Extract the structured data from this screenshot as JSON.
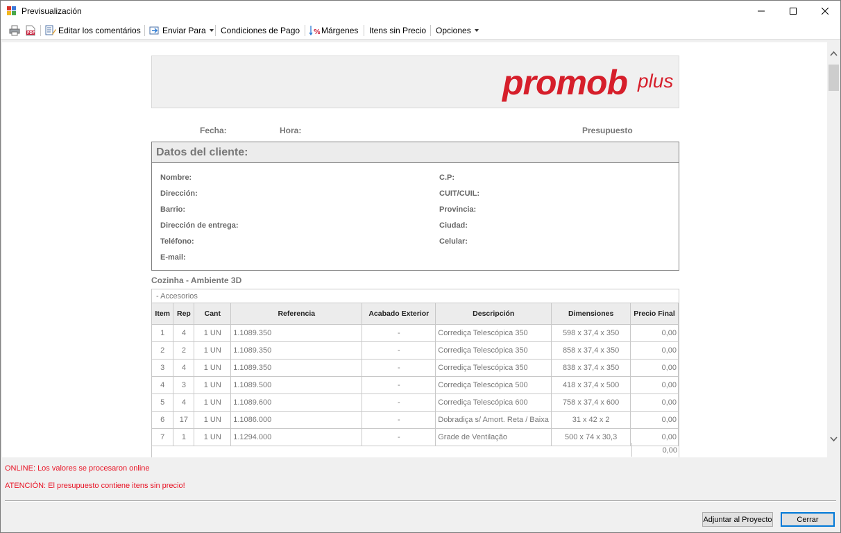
{
  "window": {
    "title": "Previsualización"
  },
  "toolbar": {
    "edit_comments": "Editar los comentários",
    "send_to": "Enviar Para",
    "payment_conditions": "Condiciones de Pago",
    "margins": "Márgenes",
    "items_no_price": "Itens sin Precio",
    "options": "Opciones"
  },
  "document": {
    "logo_main": "promob",
    "logo_plus": "plus",
    "date_label": "Fecha:",
    "time_label": "Hora:",
    "budget_label": "Presupuesto",
    "client_section": {
      "title": "Datos del cliente:",
      "left_fields": [
        "Nombre:",
        "Dirección:",
        "Barrio:",
        "Dirección de entrega:",
        "Teléfono:",
        "E-mail:"
      ],
      "right_fields": [
        "C.P:",
        "CUIT/CUIL:",
        "Provincia:",
        "Ciudad:",
        "Celular:"
      ]
    },
    "ambiente": "Cozinha - Ambiente 3D",
    "group_label": "- Accesorios",
    "columns": [
      "Item",
      "Rep",
      "Cant",
      "Referencia",
      "Acabado Exterior",
      "Descripción",
      "Dimensiones",
      "Precio Final"
    ],
    "rows": [
      [
        "1",
        "4",
        "1 UN",
        "1.1089.350",
        "-",
        "Corrediça Telescópica 350",
        "598 x 37,4 x 350",
        "0,00"
      ],
      [
        "2",
        "2",
        "1 UN",
        "1.1089.350",
        "-",
        "Corrediça Telescópica 350",
        "858 x 37,4 x 350",
        "0,00"
      ],
      [
        "3",
        "4",
        "1 UN",
        "1.1089.350",
        "-",
        "Corrediça Telescópica 350",
        "838 x 37,4 x 350",
        "0,00"
      ],
      [
        "4",
        "3",
        "1 UN",
        "1.1089.500",
        "-",
        "Corrediça Telescópica 500",
        "418 x 37,4 x 500",
        "0,00"
      ],
      [
        "5",
        "4",
        "1 UN",
        "1.1089.600",
        "-",
        "Corrediça Telescópica 600",
        "758 x 37,4 x 600",
        "0,00"
      ],
      [
        "6",
        "17",
        "1 UN",
        "1.1086.000",
        "-",
        "Dobradiça s/ Amort. Reta / Baixa",
        "31 x 42 x 2",
        "0,00"
      ],
      [
        "7",
        "1",
        "1 UN",
        "1.1294.000",
        "-",
        "Grade de Ventilação",
        "500 x 74 x 30,3",
        "0,00"
      ]
    ],
    "total": "0,00"
  },
  "messages": {
    "online": "ONLINE: Los valores se procesaron online",
    "warning": "ATENCIÓN: El presupuesto contiene itens sin precio!"
  },
  "buttons": {
    "attach": "Adjuntar al Proyecto",
    "close": "Cerrar"
  },
  "colors": {
    "brand": "#d61f2b",
    "warning_text": "#e81123",
    "primary_border": "#0078d7"
  }
}
